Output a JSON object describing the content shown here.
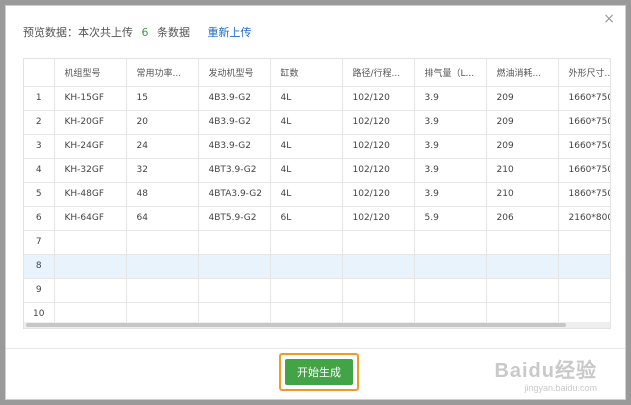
{
  "dialog": {
    "summary_prefix": "预览数据：本次共上传",
    "count": "6",
    "summary_suffix": "条数据",
    "reupload_label": "重新上传",
    "close_icon": "×",
    "generate_label": "开始生成"
  },
  "table": {
    "columns": [
      "",
      "机组型号",
      "常用功率...",
      "发动机型号",
      "缸数",
      "路径/行程...",
      "排气量（L...",
      "燃油消耗...",
      "外形尺寸..."
    ],
    "rows": [
      [
        "1",
        "KH-15GF",
        "15",
        "4B3.9-G2",
        "4L",
        "102/120",
        "3.9",
        "209",
        "1660*750"
      ],
      [
        "2",
        "KH-20GF",
        "20",
        "4B3.9-G2",
        "4L",
        "102/120",
        "3.9",
        "209",
        "1660*750"
      ],
      [
        "3",
        "KH-24GF",
        "24",
        "4B3.9-G2",
        "4L",
        "102/120",
        "3.9",
        "209",
        "1660*750"
      ],
      [
        "4",
        "KH-32GF",
        "32",
        "4BT3.9-G2",
        "4L",
        "102/120",
        "3.9",
        "210",
        "1660*750"
      ],
      [
        "5",
        "KH-48GF",
        "48",
        "4BTA3.9-G2",
        "4L",
        "102/120",
        "3.9",
        "210",
        "1860*750"
      ],
      [
        "6",
        "KH-64GF",
        "64",
        "4BT5.9-G2",
        "6L",
        "102/120",
        "5.9",
        "206",
        "2160*800"
      ],
      [
        "7",
        "",
        "",
        "",
        "",
        "",
        "",
        "",
        ""
      ],
      [
        "8",
        "",
        "",
        "",
        "",
        "",
        "",
        "",
        ""
      ],
      [
        "9",
        "",
        "",
        "",
        "",
        "",
        "",
        "",
        ""
      ],
      [
        "10",
        "",
        "",
        "",
        "",
        "",
        "",
        "",
        ""
      ]
    ],
    "selected_row": 8
  },
  "watermark": {
    "logo": "Baidu经验",
    "url": "jingyan.baidu.com"
  },
  "colors": {
    "accent_green": "#43a447",
    "link_blue": "#1f6fbf",
    "highlight_orange": "#f39a22",
    "selected_row_bg": "#e8f3fc"
  }
}
